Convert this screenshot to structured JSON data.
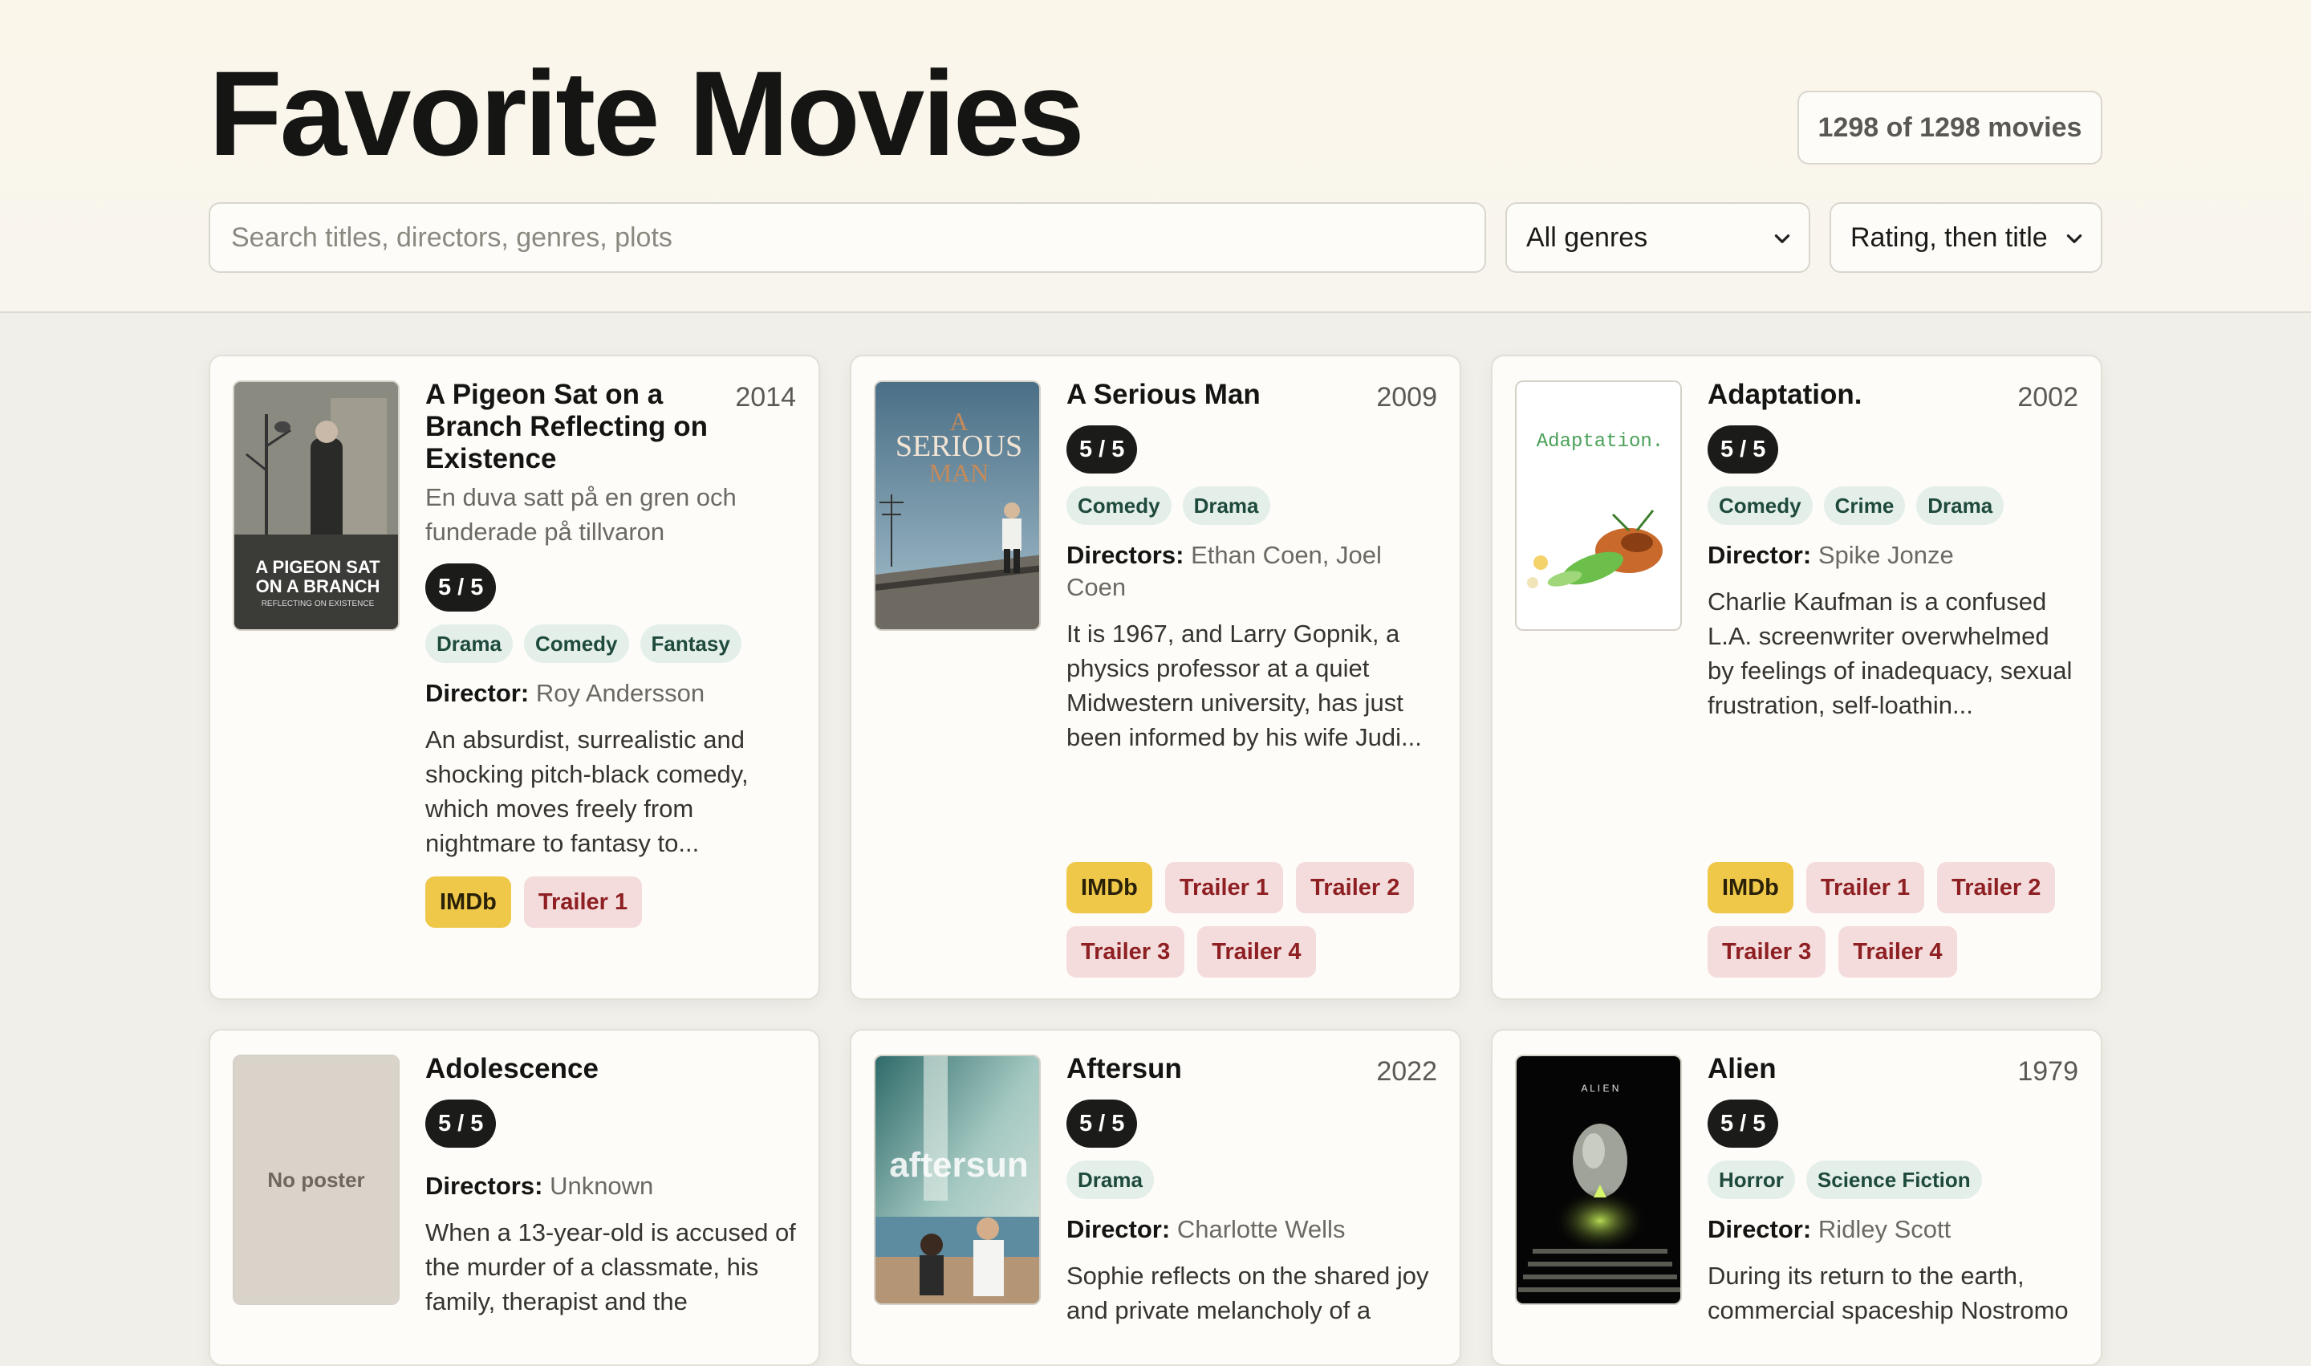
{
  "header": {
    "title": "Favorite Movies",
    "count": "1298 of 1298 movies",
    "search_placeholder": "Search titles, directors, genres, plots",
    "genre_select": "All genres",
    "sort_select": "Rating, then title"
  },
  "colors": {
    "rating_pill": "#1b1b19",
    "genre_tag": "#e4efea",
    "imdb_button": "#efc84a",
    "trailer_button": "#f5dcdc"
  },
  "cards": [
    {
      "title": "A Pigeon Sat on a Branch Reflecting on Existence",
      "year": "2014",
      "original_title": "En duva satt på en gren och funderade på tillvaron",
      "rating": "5 / 5",
      "genres": [
        "Drama",
        "Comedy",
        "Fantasy"
      ],
      "director_label": "Director:",
      "director": "Roy Andersson",
      "plot": "An absurdist, surrealistic and shocking pitch-black comedy, which moves freely from nightmare to fantasy to...",
      "poster_title": "A PIGEON SAT ON A BRANCH",
      "poster_subtitle": "REFLECTING ON EXISTENCE",
      "links": [
        "IMDb",
        "Trailer 1"
      ]
    },
    {
      "title": "A Serious Man",
      "year": "2009",
      "rating": "5 / 5",
      "genres": [
        "Comedy",
        "Drama"
      ],
      "director_label": "Directors:",
      "director": "Ethan Coen, Joel Coen",
      "plot": "It is 1967, and Larry Gopnik, a physics professor at a quiet Midwestern university, has just been informed by his wife Judi...",
      "poster_title_lines": [
        "A",
        "SERIOUS",
        "MAN"
      ],
      "links": [
        "IMDb",
        "Trailer 1",
        "Trailer 2",
        "Trailer 3",
        "Trailer 4"
      ]
    },
    {
      "title": "Adaptation.",
      "year": "2002",
      "rating": "5 / 5",
      "genres": [
        "Comedy",
        "Crime",
        "Drama"
      ],
      "director_label": "Director:",
      "director": "Spike Jonze",
      "plot": "Charlie Kaufman is a confused L.A. screenwriter overwhelmed by feelings of inadequacy, sexual frustration, self-loathin...",
      "poster_title": "Adaptation.",
      "links": [
        "IMDb",
        "Trailer 1",
        "Trailer 2",
        "Trailer 3",
        "Trailer 4"
      ]
    },
    {
      "title": "Adolescence",
      "rating": "5 / 5",
      "director_label": "Directors:",
      "director": "Unknown",
      "plot": "When a 13-year-old is accused of the murder of a classmate, his family, therapist and the",
      "poster_placeholder": "No poster"
    },
    {
      "title": "Aftersun",
      "year": "2022",
      "rating": "5 / 5",
      "genres": [
        "Drama"
      ],
      "director_label": "Director:",
      "director": "Charlotte Wells",
      "plot": "Sophie reflects on the shared joy and private melancholy of a",
      "poster_title": "aftersun"
    },
    {
      "title": "Alien",
      "year": "1979",
      "rating": "5 / 5",
      "genres": [
        "Horror",
        "Science Fiction"
      ],
      "director_label": "Director:",
      "director": "Ridley Scott",
      "plot": "During its return to the earth, commercial spaceship Nostromo",
      "poster_title": "A L I E N"
    }
  ]
}
